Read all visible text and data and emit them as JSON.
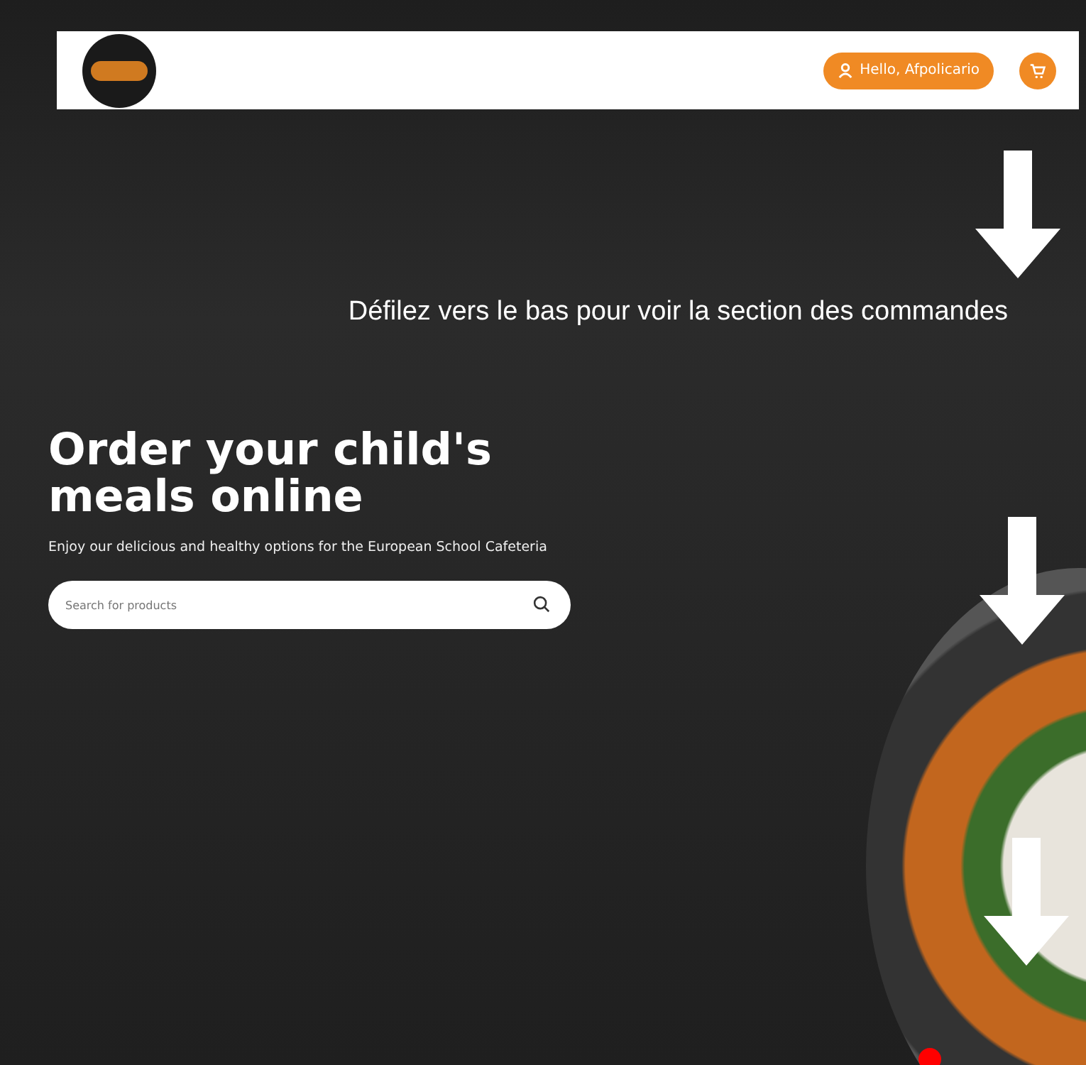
{
  "header": {
    "user_button": "Hello, Afpolicario"
  },
  "annotation": {
    "text": "Défilez vers le bas pour voir la section des commandes"
  },
  "hero": {
    "title": "Order your child's meals online",
    "subtitle": "Enjoy our delicious and healthy options for the European School Cafeteria",
    "search": {
      "placeholder": "Search for products"
    }
  }
}
